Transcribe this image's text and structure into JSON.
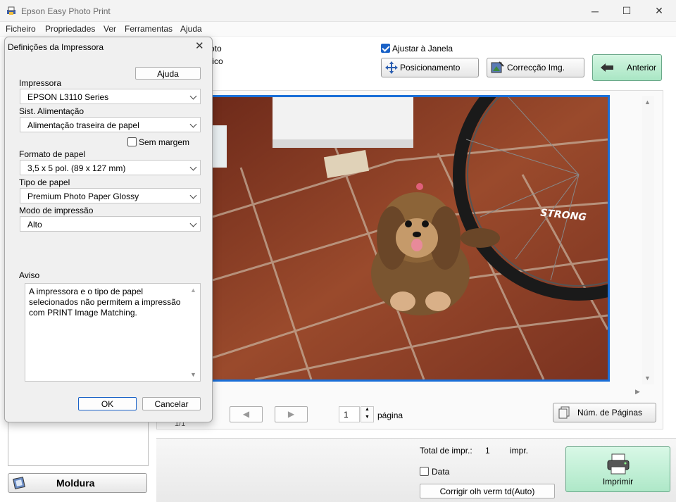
{
  "window": {
    "title": "Epson Easy Photo Print",
    "minimize": "─",
    "maximize": "☐",
    "close": "✕"
  },
  "menu": [
    "Ficheiro",
    "Propriedades",
    "Ver",
    "Ferramentas",
    "Ajuda"
  ],
  "toolbar": {
    "partial_label_1": "oto",
    "partial_label_2": "tico",
    "fit_window_label": "Ajustar à Janela",
    "fit_window_checked": true,
    "position_button": "Posicionamento",
    "correction_button": "Correcção Img.",
    "back_button": "Anterior"
  },
  "preview": {
    "photo_text": "STRONG",
    "page_counter_partial": "1/1",
    "page_value": "1",
    "page_label": "página",
    "pages_button": "Núm. de Páginas"
  },
  "left_panel": {
    "frame_button": "Moldura"
  },
  "bottom": {
    "total_label": "Total de impr.:",
    "total_value": "1",
    "total_unit": "impr.",
    "date_label": "Data",
    "date_checked": false,
    "redeye_button": "Corrigir olh verm td(Auto)",
    "print_button": "Imprimir"
  },
  "dialog": {
    "title": "Definições da Impressora",
    "help_button": "Ajuda",
    "printer_label": "Impressora",
    "printer_value": "EPSON L3110 Series",
    "source_label": "Sist. Alimentação",
    "source_value": "Alimentação traseira de papel",
    "borderless_label": "Sem margem",
    "borderless_checked": false,
    "size_label": "Formato de papel",
    "size_value": "3,5 x 5 pol. (89 x 127 mm)",
    "type_label": "Tipo de papel",
    "type_value": "Premium Photo Paper Glossy",
    "mode_label": "Modo de impressão",
    "mode_value": "Alto",
    "warning_label": "Aviso",
    "warning_text": "A impressora e o tipo de papel selecionados não permitem a impressão com PRINT Image Matching.",
    "ok_button": "OK",
    "cancel_button": "Cancelar"
  },
  "colors": {
    "accent_blue": "#1a62c7",
    "print_green": "#c9f2d9",
    "back_green": "#b8ecd0"
  }
}
